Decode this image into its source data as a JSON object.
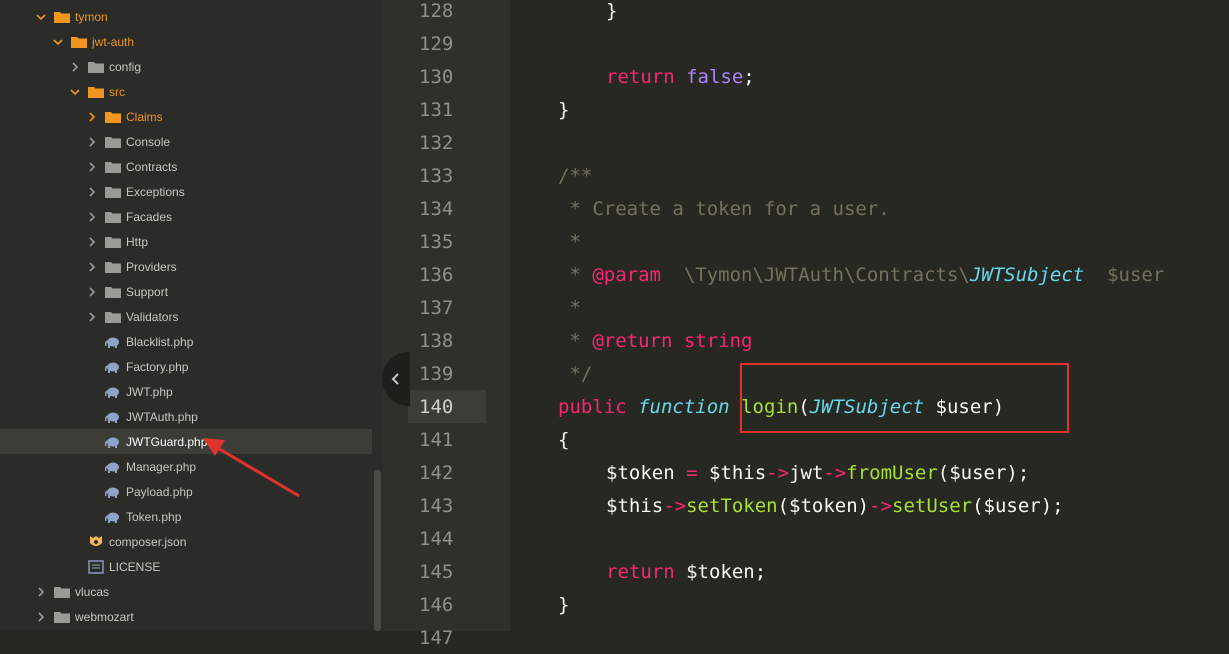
{
  "sidebar": {
    "items": [
      {
        "label": "tymon",
        "type": "folder",
        "expanded": true,
        "depth": 0
      },
      {
        "label": "jwt-auth",
        "type": "folder",
        "expanded": true,
        "depth": 1
      },
      {
        "label": "config",
        "type": "folder",
        "expanded": false,
        "depth": 2
      },
      {
        "label": "src",
        "type": "folder",
        "expanded": true,
        "depth": 2
      },
      {
        "label": "Claims",
        "type": "folder",
        "expanded": false,
        "depth": 3
      },
      {
        "label": "Console",
        "type": "folder",
        "expanded": false,
        "depth": 3
      },
      {
        "label": "Contracts",
        "type": "folder",
        "expanded": false,
        "depth": 3
      },
      {
        "label": "Exceptions",
        "type": "folder",
        "expanded": false,
        "depth": 3
      },
      {
        "label": "Facades",
        "type": "folder",
        "expanded": false,
        "depth": 3
      },
      {
        "label": "Http",
        "type": "folder",
        "expanded": false,
        "depth": 3
      },
      {
        "label": "Providers",
        "type": "folder",
        "expanded": false,
        "depth": 3
      },
      {
        "label": "Support",
        "type": "folder",
        "expanded": false,
        "depth": 3
      },
      {
        "label": "Validators",
        "type": "folder",
        "expanded": false,
        "depth": 3
      },
      {
        "label": "Blacklist.php",
        "type": "php",
        "depth": 3
      },
      {
        "label": "Factory.php",
        "type": "php",
        "depth": 3
      },
      {
        "label": "JWT.php",
        "type": "php",
        "depth": 3
      },
      {
        "label": "JWTAuth.php",
        "type": "php",
        "depth": 3
      },
      {
        "label": "JWTGuard.php",
        "type": "php",
        "depth": 3,
        "selected": true
      },
      {
        "label": "Manager.php",
        "type": "php",
        "depth": 3
      },
      {
        "label": "Payload.php",
        "type": "php",
        "depth": 3
      },
      {
        "label": "Token.php",
        "type": "php",
        "depth": 3
      },
      {
        "label": "composer.json",
        "type": "composer",
        "depth": 2
      },
      {
        "label": "LICENSE",
        "type": "license",
        "depth": 2
      },
      {
        "label": "vlucas",
        "type": "folder",
        "expanded": false,
        "depth": 0
      },
      {
        "label": "webmozart",
        "type": "folder",
        "expanded": false,
        "depth": 0
      }
    ]
  },
  "editor": {
    "current_line": "140",
    "lines": [
      {
        "num": "128",
        "tokens": [
          {
            "t": "}",
            "c": "punc"
          }
        ],
        "indent": 1
      },
      {
        "num": "129",
        "tokens": [],
        "indent": 0
      },
      {
        "num": "130",
        "tokens": [
          {
            "t": "return",
            "c": "kw"
          },
          {
            "t": " ",
            "c": "punc"
          },
          {
            "t": "false",
            "c": "const"
          },
          {
            "t": ";",
            "c": "punc"
          }
        ],
        "indent": 1
      },
      {
        "num": "131",
        "tokens": [
          {
            "t": "}",
            "c": "punc"
          }
        ],
        "indent": 0
      },
      {
        "num": "132",
        "tokens": [],
        "indent": 0
      },
      {
        "num": "133",
        "tokens": [
          {
            "t": "/**",
            "c": "comment"
          }
        ],
        "indent": 0
      },
      {
        "num": "134",
        "tokens": [
          {
            "t": " * Create a token for a user.",
            "c": "comment"
          }
        ],
        "indent": 0
      },
      {
        "num": "135",
        "tokens": [
          {
            "t": " *",
            "c": "comment"
          }
        ],
        "indent": 0
      },
      {
        "num": "136",
        "tokens": [
          {
            "t": " * ",
            "c": "comment"
          },
          {
            "t": "@param",
            "c": "doc-tag"
          },
          {
            "t": "  \\Tymon\\JWTAuth\\Contracts\\",
            "c": "comment"
          },
          {
            "t": "JWTSubject",
            "c": "doc-type"
          },
          {
            "t": "  $user",
            "c": "comment"
          }
        ],
        "indent": 0
      },
      {
        "num": "137",
        "tokens": [
          {
            "t": " *",
            "c": "comment"
          }
        ],
        "indent": 0
      },
      {
        "num": "138",
        "tokens": [
          {
            "t": " * ",
            "c": "comment"
          },
          {
            "t": "@return",
            "c": "doc-tag"
          },
          {
            "t": " string",
            "c": "kw"
          }
        ],
        "indent": 0
      },
      {
        "num": "139",
        "tokens": [
          {
            "t": " */",
            "c": "comment"
          }
        ],
        "indent": 0
      },
      {
        "num": "140",
        "tokens": [
          {
            "t": "public",
            "c": "kw"
          },
          {
            "t": " ",
            "c": "punc"
          },
          {
            "t": "function",
            "c": "fn-kw"
          },
          {
            "t": " ",
            "c": "punc"
          },
          {
            "t": "login",
            "c": "fn-name"
          },
          {
            "t": "(",
            "c": "punc"
          },
          {
            "t": "JWTSubject",
            "c": "cls"
          },
          {
            "t": " $user)",
            "c": "punc"
          }
        ],
        "indent": 0
      },
      {
        "num": "141",
        "tokens": [
          {
            "t": "{",
            "c": "punc"
          }
        ],
        "indent": 0
      },
      {
        "num": "142",
        "tokens": [
          {
            "t": "$token",
            "c": "var"
          },
          {
            "t": " = ",
            "c": "op"
          },
          {
            "t": "$this",
            "c": "var"
          },
          {
            "t": "->",
            "c": "op"
          },
          {
            "t": "jwt",
            "c": "var"
          },
          {
            "t": "->",
            "c": "op"
          },
          {
            "t": "fromUser",
            "c": "fn-name"
          },
          {
            "t": "($user);",
            "c": "punc"
          }
        ],
        "indent": 1
      },
      {
        "num": "143",
        "tokens": [
          {
            "t": "$this",
            "c": "var"
          },
          {
            "t": "->",
            "c": "op"
          },
          {
            "t": "setToken",
            "c": "fn-name"
          },
          {
            "t": "($token)",
            "c": "punc"
          },
          {
            "t": "->",
            "c": "op"
          },
          {
            "t": "setUser",
            "c": "fn-name"
          },
          {
            "t": "($user);",
            "c": "punc"
          }
        ],
        "indent": 1
      },
      {
        "num": "144",
        "tokens": [],
        "indent": 0
      },
      {
        "num": "145",
        "tokens": [
          {
            "t": "return",
            "c": "kw"
          },
          {
            "t": " $token;",
            "c": "punc"
          }
        ],
        "indent": 1
      },
      {
        "num": "146",
        "tokens": [
          {
            "t": "}",
            "c": "punc"
          }
        ],
        "indent": 0
      },
      {
        "num": "147",
        "tokens": [],
        "indent": 0
      }
    ]
  },
  "colors": {
    "folder_default": "#9a9b95",
    "folder_active": "#f0951f",
    "php_icon": "#8fa3c7",
    "highlight_red": "#e0332e"
  },
  "icons": {
    "collapse": "chevron-left-icon",
    "folder": "folder-icon",
    "php": "php-elephant-icon",
    "composer": "composer-icon",
    "license": "license-file-icon"
  }
}
